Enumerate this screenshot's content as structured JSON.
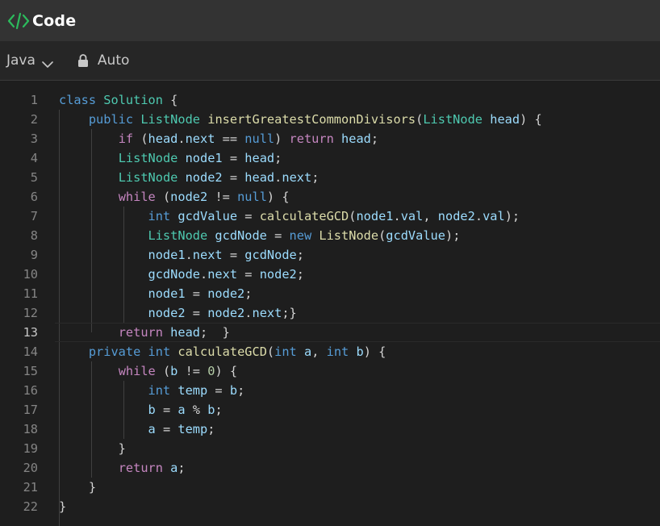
{
  "app": {
    "title": "Code"
  },
  "toolbar": {
    "language": "Java",
    "mode": "Auto"
  },
  "editor": {
    "active_line": 13,
    "lines": [
      {
        "n": "1",
        "tokens": [
          [
            "kw",
            "class"
          ],
          [
            "tx",
            " "
          ],
          [
            "ty",
            "Solution"
          ],
          [
            "tx",
            " {"
          ]
        ]
      },
      {
        "n": "2",
        "tokens": [
          [
            "tx",
            "    "
          ],
          [
            "kw",
            "public"
          ],
          [
            "tx",
            " "
          ],
          [
            "ty",
            "ListNode"
          ],
          [
            "tx",
            " "
          ],
          [
            "fn",
            "insertGreatestCommonDivisors"
          ],
          [
            "tx",
            "("
          ],
          [
            "ty",
            "ListNode"
          ],
          [
            "tx",
            " "
          ],
          [
            "vr",
            "head"
          ],
          [
            "tx",
            ") {"
          ]
        ]
      },
      {
        "n": "3",
        "tokens": [
          [
            "tx",
            "        "
          ],
          [
            "ctl",
            "if"
          ],
          [
            "tx",
            " ("
          ],
          [
            "vr",
            "head"
          ],
          [
            "tx",
            "."
          ],
          [
            "vr",
            "next"
          ],
          [
            "tx",
            " == "
          ],
          [
            "kw",
            "null"
          ],
          [
            "tx",
            ") "
          ],
          [
            "ctl",
            "return"
          ],
          [
            "tx",
            " "
          ],
          [
            "vr",
            "head"
          ],
          [
            "tx",
            ";"
          ]
        ]
      },
      {
        "n": "4",
        "tokens": [
          [
            "tx",
            "        "
          ],
          [
            "ty",
            "ListNode"
          ],
          [
            "tx",
            " "
          ],
          [
            "vr",
            "node1"
          ],
          [
            "tx",
            " = "
          ],
          [
            "vr",
            "head"
          ],
          [
            "tx",
            ";"
          ]
        ]
      },
      {
        "n": "5",
        "tokens": [
          [
            "tx",
            "        "
          ],
          [
            "ty",
            "ListNode"
          ],
          [
            "tx",
            " "
          ],
          [
            "vr",
            "node2"
          ],
          [
            "tx",
            " = "
          ],
          [
            "vr",
            "head"
          ],
          [
            "tx",
            "."
          ],
          [
            "vr",
            "next"
          ],
          [
            "tx",
            ";"
          ]
        ]
      },
      {
        "n": "6",
        "tokens": [
          [
            "tx",
            "        "
          ],
          [
            "ctl",
            "while"
          ],
          [
            "tx",
            " ("
          ],
          [
            "vr",
            "node2"
          ],
          [
            "tx",
            " != "
          ],
          [
            "kw",
            "null"
          ],
          [
            "tx",
            ") {"
          ]
        ]
      },
      {
        "n": "7",
        "tokens": [
          [
            "tx",
            "            "
          ],
          [
            "kw",
            "int"
          ],
          [
            "tx",
            " "
          ],
          [
            "vr",
            "gcdValue"
          ],
          [
            "tx",
            " = "
          ],
          [
            "fn",
            "calculateGCD"
          ],
          [
            "tx",
            "("
          ],
          [
            "vr",
            "node1"
          ],
          [
            "tx",
            "."
          ],
          [
            "vr",
            "val"
          ],
          [
            "tx",
            ", "
          ],
          [
            "vr",
            "node2"
          ],
          [
            "tx",
            "."
          ],
          [
            "vr",
            "val"
          ],
          [
            "tx",
            ");"
          ]
        ]
      },
      {
        "n": "8",
        "tokens": [
          [
            "tx",
            "            "
          ],
          [
            "ty",
            "ListNode"
          ],
          [
            "tx",
            " "
          ],
          [
            "vr",
            "gcdNode"
          ],
          [
            "tx",
            " = "
          ],
          [
            "kw",
            "new"
          ],
          [
            "tx",
            " "
          ],
          [
            "fn",
            "ListNode"
          ],
          [
            "tx",
            "("
          ],
          [
            "vr",
            "gcdValue"
          ],
          [
            "tx",
            ");"
          ]
        ]
      },
      {
        "n": "9",
        "tokens": [
          [
            "tx",
            "            "
          ],
          [
            "vr",
            "node1"
          ],
          [
            "tx",
            "."
          ],
          [
            "vr",
            "next"
          ],
          [
            "tx",
            " = "
          ],
          [
            "vr",
            "gcdNode"
          ],
          [
            "tx",
            ";"
          ]
        ]
      },
      {
        "n": "10",
        "tokens": [
          [
            "tx",
            "            "
          ],
          [
            "vr",
            "gcdNode"
          ],
          [
            "tx",
            "."
          ],
          [
            "vr",
            "next"
          ],
          [
            "tx",
            " = "
          ],
          [
            "vr",
            "node2"
          ],
          [
            "tx",
            ";"
          ]
        ]
      },
      {
        "n": "11",
        "tokens": [
          [
            "tx",
            "            "
          ],
          [
            "vr",
            "node1"
          ],
          [
            "tx",
            " = "
          ],
          [
            "vr",
            "node2"
          ],
          [
            "tx",
            ";"
          ]
        ]
      },
      {
        "n": "12",
        "tokens": [
          [
            "tx",
            "            "
          ],
          [
            "vr",
            "node2"
          ],
          [
            "tx",
            " = "
          ],
          [
            "vr",
            "node2"
          ],
          [
            "tx",
            "."
          ],
          [
            "vr",
            "next"
          ],
          [
            "tx",
            ";}"
          ]
        ]
      },
      {
        "n": "13",
        "tokens": [
          [
            "tx",
            "        "
          ],
          [
            "ctl",
            "return"
          ],
          [
            "tx",
            " "
          ],
          [
            "vr",
            "head"
          ],
          [
            "tx",
            ";  }"
          ]
        ]
      },
      {
        "n": "14",
        "tokens": [
          [
            "tx",
            "    "
          ],
          [
            "kw",
            "private"
          ],
          [
            "tx",
            " "
          ],
          [
            "kw",
            "int"
          ],
          [
            "tx",
            " "
          ],
          [
            "fn",
            "calculateGCD"
          ],
          [
            "tx",
            "("
          ],
          [
            "kw",
            "int"
          ],
          [
            "tx",
            " "
          ],
          [
            "vr",
            "a"
          ],
          [
            "tx",
            ", "
          ],
          [
            "kw",
            "int"
          ],
          [
            "tx",
            " "
          ],
          [
            "vr",
            "b"
          ],
          [
            "tx",
            ") {"
          ]
        ]
      },
      {
        "n": "15",
        "tokens": [
          [
            "tx",
            "        "
          ],
          [
            "ctl",
            "while"
          ],
          [
            "tx",
            " ("
          ],
          [
            "vr",
            "b"
          ],
          [
            "tx",
            " != "
          ],
          [
            "nm",
            "0"
          ],
          [
            "tx",
            ") {"
          ]
        ]
      },
      {
        "n": "16",
        "tokens": [
          [
            "tx",
            "            "
          ],
          [
            "kw",
            "int"
          ],
          [
            "tx",
            " "
          ],
          [
            "vr",
            "temp"
          ],
          [
            "tx",
            " = "
          ],
          [
            "vr",
            "b"
          ],
          [
            "tx",
            ";"
          ]
        ]
      },
      {
        "n": "17",
        "tokens": [
          [
            "tx",
            "            "
          ],
          [
            "vr",
            "b"
          ],
          [
            "tx",
            " = "
          ],
          [
            "vr",
            "a"
          ],
          [
            "tx",
            " % "
          ],
          [
            "vr",
            "b"
          ],
          [
            "tx",
            ";"
          ]
        ]
      },
      {
        "n": "18",
        "tokens": [
          [
            "tx",
            "            "
          ],
          [
            "vr",
            "a"
          ],
          [
            "tx",
            " = "
          ],
          [
            "vr",
            "temp"
          ],
          [
            "tx",
            ";"
          ]
        ]
      },
      {
        "n": "19",
        "tokens": [
          [
            "tx",
            "        }"
          ]
        ]
      },
      {
        "n": "20",
        "tokens": [
          [
            "tx",
            "        "
          ],
          [
            "ctl",
            "return"
          ],
          [
            "tx",
            " "
          ],
          [
            "vr",
            "a"
          ],
          [
            "tx",
            ";"
          ]
        ]
      },
      {
        "n": "21",
        "tokens": [
          [
            "tx",
            "    }"
          ]
        ]
      },
      {
        "n": "22",
        "tokens": [
          [
            "tx",
            "}"
          ]
        ]
      }
    ]
  },
  "icons": {
    "logo": "code-brackets-icon",
    "language_dropdown": "chevron-down-icon",
    "mode": "lock-icon"
  },
  "colors": {
    "logo_green": "#2cbb5d",
    "keyword": "#569cd6",
    "control": "#c586c0",
    "type": "#4ec9b0",
    "function": "#dcdcaa",
    "variable": "#9cdcfe",
    "number": "#b5cea8",
    "text": "#d4d4d4"
  }
}
